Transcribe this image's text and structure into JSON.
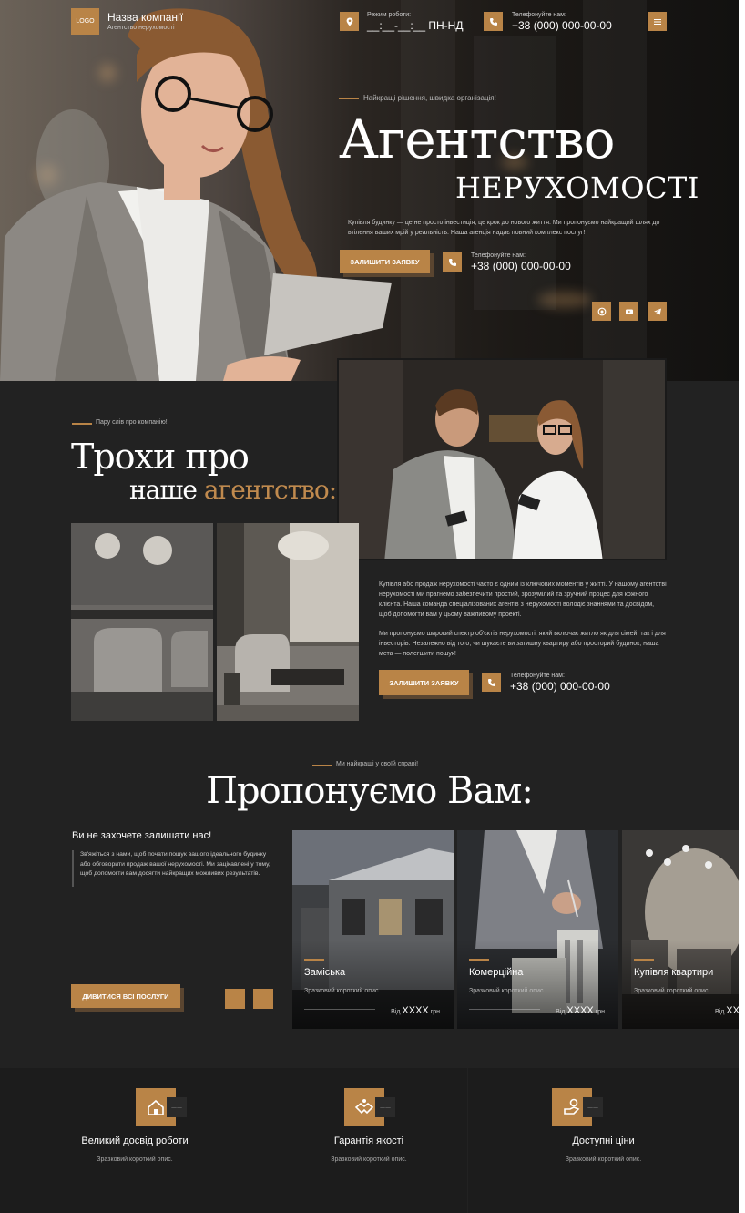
{
  "header": {
    "logo": "LOGO",
    "company_name": "Назва компанії",
    "company_sub": "Агентство нерухомості",
    "hours_label": "Режим роботи:",
    "hours_value": "__:__-__:__ ПН-НД",
    "phone_label": "Телефонуйте нам:",
    "phone_value": "+38 (000) 000-00-00",
    "menu_icon": "menu-icon"
  },
  "hero": {
    "eyebrow": "Найкращі рішення, швидка організація!",
    "title_line1": "Агентство",
    "title_line2": "НЕРУХОМОСТІ",
    "paragraph": "Купівля будинку — це не просто інвестиція, це крок до нового життя. Ми пропонуємо найкращий шлях до втілення ваших мрій у реальність. Наша агенція надає повний комплекс послуг!",
    "cta": "ЗАЛИШИТИ ЗАЯВКУ",
    "phone_label": "Телефонуйте нам:",
    "phone_value": "+38 (000) 000-00-00",
    "socials": [
      "whatsapp-icon",
      "youtube-icon",
      "telegram-icon"
    ]
  },
  "about": {
    "eyebrow": "Пару слів про компанію!",
    "title_line1": "Трохи про",
    "title_line2_white": "наше ",
    "title_line2_gold": "агентство:",
    "paragraph1": "Купівля або продаж нерухомості часто є одним із ключових моментів у житті. У нашому агентстві нерухомості ми прагнемо забезпечити простий, зрозумілий та зручний процес для кожного клієнта. Наша команда спеціалізованих агентів з нерухомості володіє знаннями та досвідом, щоб допомогти вам у цьому важливому проекті.",
    "paragraph2": "Ми пропонуємо широкий спектр об'єктів нерухомості, який включає житло як для сімей, так і для інвесторів. Незалежно від того, чи шукаєте ви затишну квартиру або просторий будинок, наша мета — полегшити пошук!",
    "cta": "ЗАЛИШИТИ ЗАЯВКУ",
    "phone_label": "Телефонуйте нам:",
    "phone_value": "+38 (000) 000-00-00"
  },
  "services": {
    "eyebrow": "Ми найкращі у своїй справі!",
    "title": "Пропонуємо Вам:",
    "subtitle": "Ви не захочете залишати нас!",
    "text": "Зв'яжіться з нами, щоб почати пошук вашого ідеального будинку або обговорити продаж вашої нерухомості. Ми зацікавлені у тому, щоб допомогти вам досягти найкращих можливих результатів.",
    "cta": "ДИВИТИСЯ ВСІ ПОСЛУГИ",
    "cards": [
      {
        "title": "Заміська",
        "desc": "Зразковий короткий опис.",
        "price_prefix": "Від",
        "price": "XXXX",
        "price_suffix": "грн."
      },
      {
        "title": "Комерційна",
        "desc": "Зразковий короткий опис.",
        "price_prefix": "Від",
        "price": "XXXX",
        "price_suffix": "грн."
      },
      {
        "title": "Купівля квартири",
        "desc": "Зразковий короткий опис.",
        "price_prefix": "Від",
        "price": "XX",
        "price_suffix": ""
      }
    ]
  },
  "features": [
    {
      "title": "Великий досвід роботи",
      "desc": "Зразковий короткий опис.",
      "badge": "——"
    },
    {
      "title": "Гарантія якості",
      "desc": "Зразковий короткий опис.",
      "badge": "——"
    },
    {
      "title": "Доступні ціни",
      "desc": "Зразковий короткий опис.",
      "badge": "——"
    }
  ],
  "colors": {
    "accent": "#b98447",
    "bg": "#222222",
    "dark": "#1c1c1c"
  }
}
